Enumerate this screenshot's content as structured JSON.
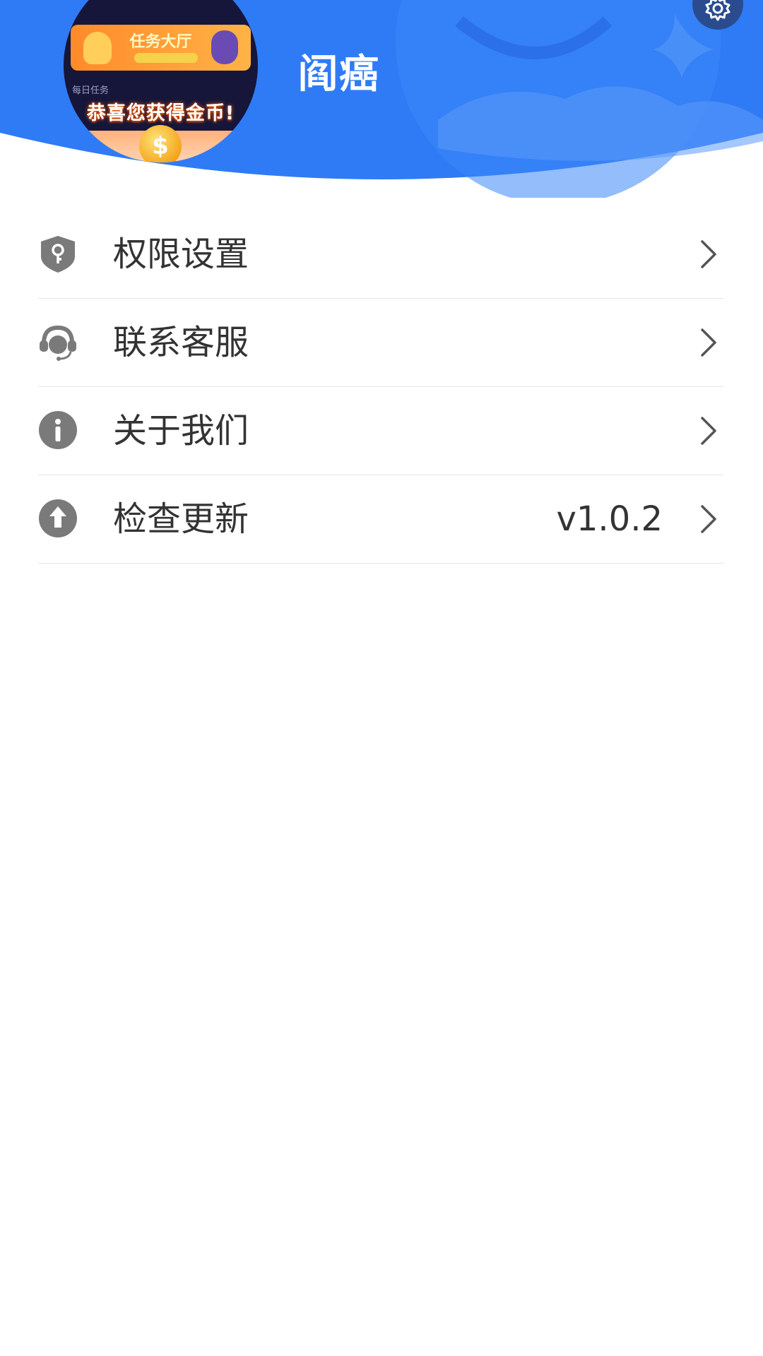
{
  "header": {
    "app_name": "阎癌",
    "avatar": {
      "banner_title": "任务大厅",
      "section_caption": "每日任务",
      "reward_text": "恭喜您获得金币!",
      "coin_symbol": "$"
    },
    "settings_icon": "gear-icon",
    "colors": {
      "header_blue": "#2f7bf6",
      "settings_bg": "#2a4c8f"
    }
  },
  "menu": {
    "items": [
      {
        "label": "权限设置",
        "icon": "shield-key-icon",
        "value": ""
      },
      {
        "label": "联系客服",
        "icon": "headset-icon",
        "value": ""
      },
      {
        "label": "关于我们",
        "icon": "info-icon",
        "value": ""
      },
      {
        "label": "检查更新",
        "icon": "upload-arrow-icon",
        "value": "v1.0.2"
      }
    ]
  }
}
